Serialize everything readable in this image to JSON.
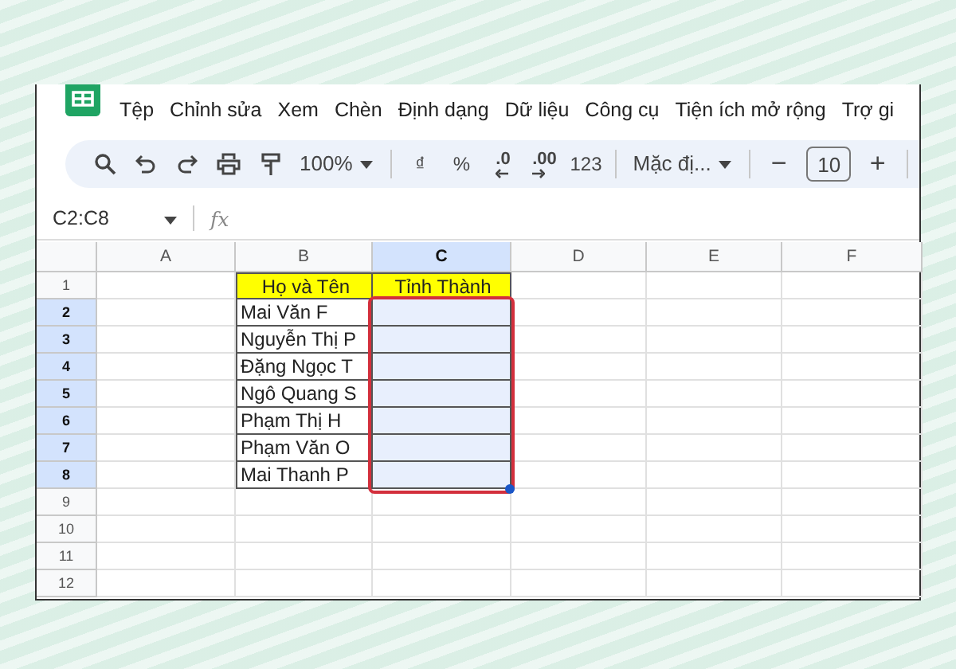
{
  "menu": [
    "Tệp",
    "Chỉnh sửa",
    "Xem",
    "Chèn",
    "Định dạng",
    "Dữ liệu",
    "Công cụ",
    "Tiện ích mở rộng",
    "Trợ gi"
  ],
  "toolbar": [
    {
      "kind": "search"
    },
    {
      "kind": "undo"
    },
    {
      "kind": "redo"
    },
    {
      "kind": "print"
    },
    {
      "kind": "paint"
    },
    {
      "kind": "dropdown",
      "label": "100%"
    },
    {
      "kind": "separator"
    },
    {
      "kind": "text",
      "label": "₫"
    },
    {
      "kind": "text",
      "label": "%"
    },
    {
      "kind": "decimal-decrease",
      "label": ".0"
    },
    {
      "kind": "decimal-increase",
      "label": ".00"
    },
    {
      "kind": "text",
      "label": "123"
    },
    {
      "kind": "separator"
    },
    {
      "kind": "dropdown",
      "label": "Mặc đị..."
    },
    {
      "kind": "separator"
    },
    {
      "kind": "minus",
      "label": "−"
    },
    {
      "kind": "field",
      "value": "10"
    },
    {
      "kind": "plus",
      "label": "+"
    },
    {
      "kind": "separator"
    }
  ],
  "formula_bar": {
    "name_box": "C2:C8",
    "fx": "fx"
  },
  "columns": [
    {
      "label": "A",
      "selected": false,
      "bordered": false
    },
    {
      "label": "B",
      "selected": false,
      "bordered": true
    },
    {
      "label": "C",
      "selected": true,
      "bordered": true
    },
    {
      "label": "D",
      "selected": false,
      "bordered": false
    },
    {
      "label": "E",
      "selected": false,
      "bordered": false
    },
    {
      "label": "F",
      "selected": false,
      "bordered": false
    }
  ],
  "rows": [
    {
      "number": "1",
      "kind": "header",
      "selected": false,
      "bordered": true,
      "column_b": "Họ và Tên",
      "column_c": "Tỉnh Thành"
    },
    {
      "number": "2",
      "kind": "data",
      "selected": true,
      "bordered": true,
      "column_b": "Mai Văn F"
    },
    {
      "number": "3",
      "kind": "data",
      "selected": true,
      "bordered": true,
      "column_b": "Nguyễn Thị P"
    },
    {
      "number": "4",
      "kind": "data",
      "selected": true,
      "bordered": true,
      "column_b": "Đặng Ngọc T"
    },
    {
      "number": "5",
      "kind": "data",
      "selected": true,
      "bordered": true,
      "column_b": "Ngô Quang S"
    },
    {
      "number": "6",
      "kind": "data",
      "selected": true,
      "bordered": true,
      "column_b": "Phạm Thị H"
    },
    {
      "number": "7",
      "kind": "data",
      "selected": true,
      "bordered": true,
      "column_b": "Phạm Văn O"
    },
    {
      "number": "8",
      "kind": "data",
      "selected": true,
      "bordered": true,
      "column_b": "Mai Thanh P"
    },
    {
      "number": "9",
      "kind": "data",
      "selected": false,
      "bordered": false
    },
    {
      "number": "10",
      "kind": "data",
      "selected": false,
      "bordered": false
    },
    {
      "number": "11",
      "kind": "data",
      "selected": false,
      "bordered": false
    },
    {
      "number": "12",
      "kind": "data",
      "selected": false,
      "bordered": false
    }
  ],
  "selection_outline": true
}
